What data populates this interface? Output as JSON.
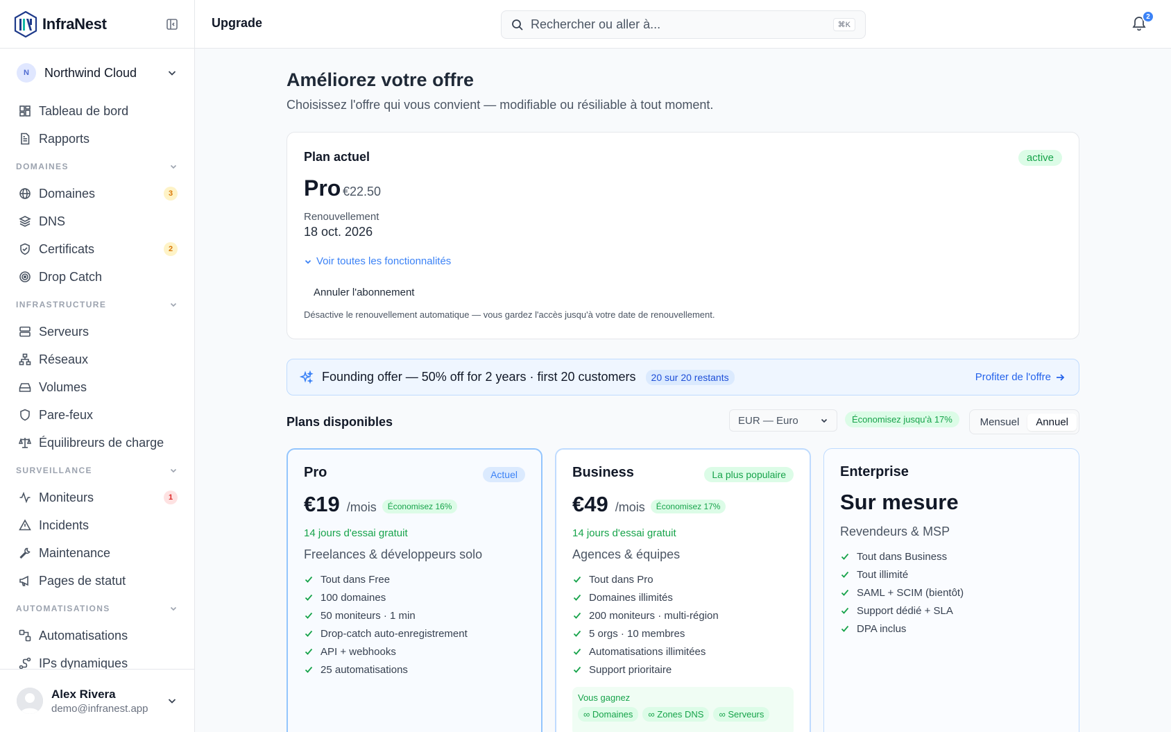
{
  "app": {
    "name": "InfraNest"
  },
  "topbar": {
    "page": "Upgrade",
    "search_placeholder": "Rechercher ou aller à...",
    "search_shortcut": "⌘K",
    "notifications_count": "2"
  },
  "org": {
    "initial": "N",
    "name": "Northwind Cloud"
  },
  "nav": {
    "top": [
      {
        "label": "Tableau de bord",
        "icon": "dashboard-icon"
      },
      {
        "label": "Rapports",
        "icon": "report-icon"
      }
    ],
    "sections": [
      {
        "label": "DOMAINES",
        "items": [
          {
            "label": "Domaines",
            "icon": "globe-icon",
            "badge": "3",
            "badge_color": "amber"
          },
          {
            "label": "DNS",
            "icon": "layers-icon"
          },
          {
            "label": "Certificats",
            "icon": "shield-check-icon",
            "badge": "2",
            "badge_color": "amber"
          },
          {
            "label": "Drop Catch",
            "icon": "target-icon"
          }
        ]
      },
      {
        "label": "INFRASTRUCTURE",
        "items": [
          {
            "label": "Serveurs",
            "icon": "server-icon"
          },
          {
            "label": "Réseaux",
            "icon": "network-icon"
          },
          {
            "label": "Volumes",
            "icon": "hard-drive-icon"
          },
          {
            "label": "Pare-feux",
            "icon": "shield-icon"
          },
          {
            "label": "Équilibreurs de charge",
            "icon": "scale-icon"
          }
        ]
      },
      {
        "label": "SURVEILLANCE",
        "items": [
          {
            "label": "Moniteurs",
            "icon": "activity-icon",
            "badge": "1",
            "badge_color": "red"
          },
          {
            "label": "Incidents",
            "icon": "warning-icon"
          },
          {
            "label": "Maintenance",
            "icon": "wrench-icon"
          },
          {
            "label": "Pages de statut",
            "icon": "megaphone-icon"
          }
        ]
      },
      {
        "label": "AUTOMATISATIONS",
        "items": [
          {
            "label": "Automatisations",
            "icon": "workflow-icon"
          },
          {
            "label": "IPs dynamiques",
            "icon": "dynamic-ip-icon"
          }
        ]
      }
    ]
  },
  "user": {
    "name": "Alex Rivera",
    "email": "demo@infranest.app"
  },
  "main": {
    "title": "Améliorez votre offre",
    "subtitle": "Choisissez l'offre qui vous convient — modifiable ou résiliable à tout moment."
  },
  "current_plan": {
    "heading": "Plan actuel",
    "status": "active",
    "plan": "Pro",
    "price": "€22.50",
    "renewal_label": "Renouvellement",
    "renewal_date": "18 oct. 2026",
    "features_link": "Voir toutes les fonctionnalités",
    "cancel_label": "Annuler l'abonnement",
    "cancel_note": "Désactive le renouvellement automatique — vous gardez l'accès jusqu'à votre date de renouvellement."
  },
  "offer": {
    "text": "Founding offer — 50% off for 2 years · first 20 customers",
    "remaining": "20 sur 20 restants",
    "cta": "Profiter de l'offre"
  },
  "plans_header": {
    "title": "Plans disponibles",
    "currency": "EUR — Euro",
    "save_upto": "Économisez jusqu'à 17%",
    "monthly": "Mensuel",
    "annual": "Annuel",
    "selected_billing": "Annuel"
  },
  "plans": [
    {
      "name": "Pro",
      "tag": "Actuel",
      "price": "€19",
      "per": "/mois",
      "save": "Économisez 16%",
      "trial": "14 jours d'essai gratuit",
      "audience": "Freelances & développeurs solo",
      "features": [
        "Tout dans Free",
        "100 domaines",
        "50 moniteurs · 1 min",
        "Drop-catch auto-enregistrement",
        "API + webhooks",
        "25 automatisations"
      ]
    },
    {
      "name": "Business",
      "tag": "La plus populaire",
      "price": "€49",
      "per": "/mois",
      "save": "Économisez 17%",
      "trial": "14 jours d'essai gratuit",
      "audience": "Agences & équipes",
      "features": [
        "Tout dans Pro",
        "Domaines illimités",
        "200 moniteurs · multi-région",
        "5 orgs · 10 membres",
        "Automatisations illimitées",
        "Support prioritaire"
      ],
      "gains_title": "Vous gagnez",
      "gains": [
        "∞ Domaines",
        "∞ Zones DNS",
        "∞ Serveurs"
      ]
    },
    {
      "name": "Enterprise",
      "price": "Sur mesure",
      "audience": "Revendeurs & MSP",
      "features": [
        "Tout dans Business",
        "Tout illimité",
        "SAML + SCIM (bientôt)",
        "Support dédié + SLA",
        "DPA inclus"
      ]
    }
  ],
  "colors": {
    "accent": "#3b82f6",
    "success": "#16a34a",
    "warning": "#d97706",
    "danger": "#dc2626"
  }
}
